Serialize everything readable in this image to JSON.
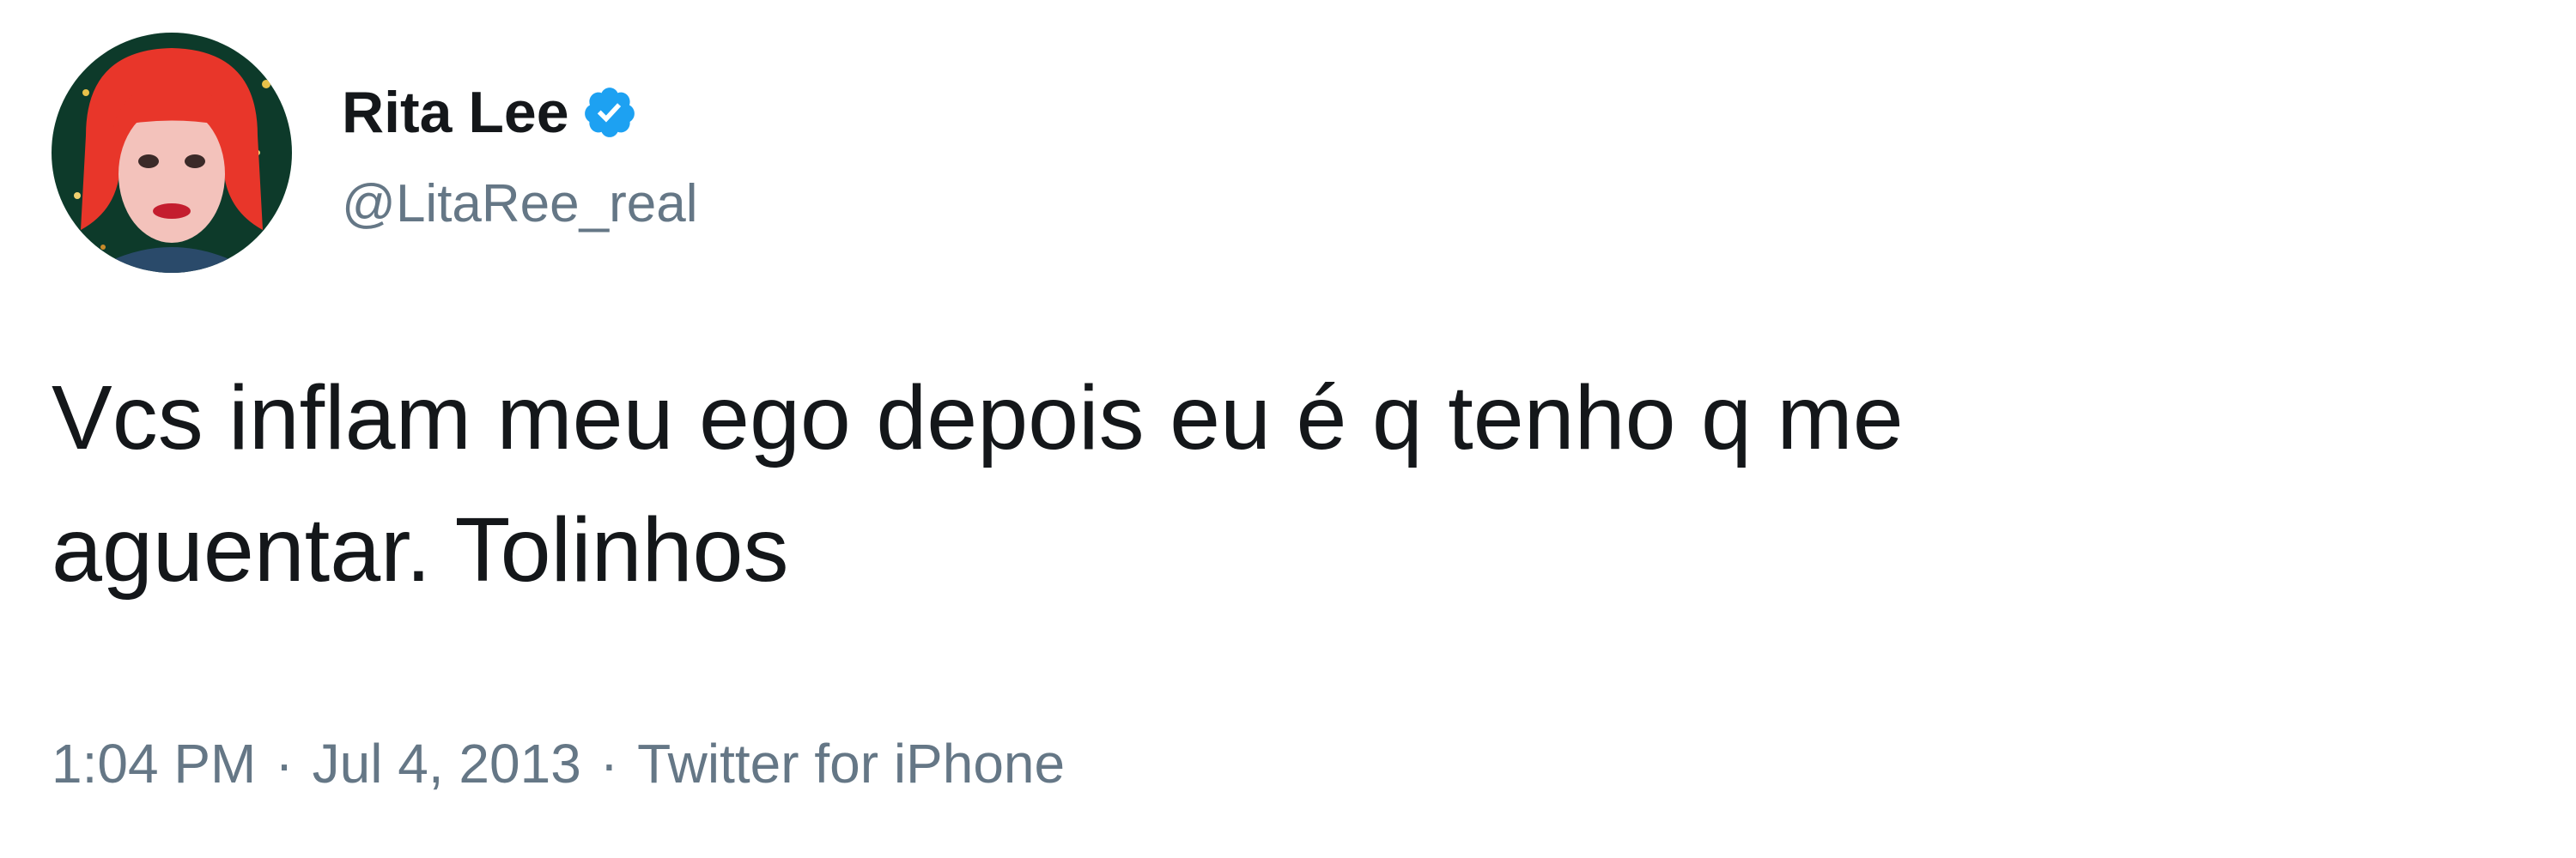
{
  "tweet": {
    "display_name": "Rita Lee",
    "verified_icon": "verified-badge-icon",
    "handle": "@LitaRee_real",
    "text": "Vcs inflam meu ego depois eu é q tenho q me\naguentar. Tolinhos",
    "time": "1:04 PM",
    "separator": "·",
    "date": "Jul 4, 2013",
    "source": "Twitter for iPhone"
  },
  "colors": {
    "primary_text": "#14171a",
    "secondary_text": "#657786",
    "verified_blue": "#1da1f2",
    "background": "#ffffff"
  }
}
